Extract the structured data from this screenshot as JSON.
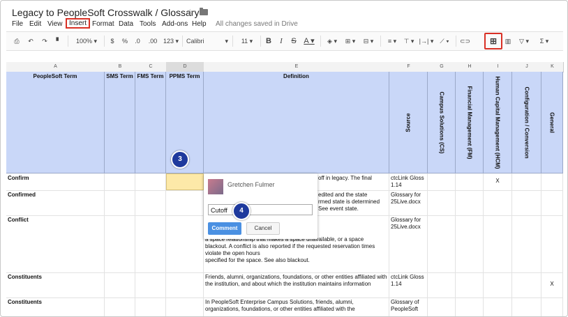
{
  "doc": {
    "title": "Legacy to PeopleSoft Crosswalk / Glossary",
    "saved_status": "All changes saved in Drive"
  },
  "menu": [
    "File",
    "Edit",
    "View",
    "Insert",
    "Format",
    "Data",
    "Tools",
    "Add-ons",
    "Help"
  ],
  "toolbar": {
    "zoom": "100%",
    "currency": "$",
    "percent": "%",
    "dec_less": ".0",
    "dec_more": ".00",
    "format_more": "123 ▾",
    "font": "Calibri",
    "font_size": "11",
    "bold": "B",
    "italic": "I",
    "strike": "S",
    "text_color": "A",
    "sigma": "Σ ▾"
  },
  "columns": [
    "A",
    "B",
    "C",
    "D",
    "E",
    "F",
    "G",
    "H",
    "I",
    "J",
    "K"
  ],
  "header_row": {
    "a": "PeopleSoft Term",
    "b": "SMS Term",
    "c": "FMS Term",
    "d": "PPMS Term",
    "e": "Definition",
    "f": "Source",
    "g": "Campus Solutions (CS)",
    "h": "Financial Management (FM)",
    "i": "Human Capital Management (HCM)",
    "j": "Configuration / Conversion",
    "k": "General"
  },
  "rows": [
    {
      "term": "Confirm",
      "def": "off in legacy.  The final",
      "source": "ctcLink Gloss 1.14",
      "i": "X",
      "k": ""
    },
    {
      "term": "Confirmed",
      "def": "edited and the state\nrmed state is determined\nSee event state.",
      "source": "Glossary for 25Live.docx",
      "i": "",
      "k": ""
    },
    {
      "term": "Conflict",
      "def": "n the Assign Spaces page\nnflict for a reservation\nap with another event(s),\na space relationship that makes a space unavailable, or a space blackout. A conflict is also reported if the requested reservation times violate the open hours\nspecified for the space. See also blackout.",
      "source": "Glossary for 25Live.docx",
      "i": "",
      "k": ""
    },
    {
      "term": "Constituents",
      "def": "Friends, alumni, organizations, foundations, or other entities affiliated with the institution, and about which the institution maintains information",
      "source": "ctcLink Gloss 1.14",
      "i": "",
      "k": "X"
    },
    {
      "term": "Constituents",
      "def": "In PeopleSoft Enterprise Campus Solutions, friends, alumni, organizations, foundations, or other entities affiliated with the",
      "source": "Glossary of PeopleSoft",
      "i": "",
      "k": ""
    }
  ],
  "comment_popup": {
    "author": "Gretchen Fulmer",
    "input_value": "Cutoff",
    "comment_label": "Comment",
    "cancel_label": "Cancel"
  },
  "callouts": {
    "step3": "3",
    "step4": "4"
  },
  "colors": {
    "header_fill": "#c9d7f8",
    "selected_cell": "#fde9a8",
    "highlight_border": "#d93025",
    "comment_button": "#4a90e2",
    "badge": "#1f3a9d"
  }
}
